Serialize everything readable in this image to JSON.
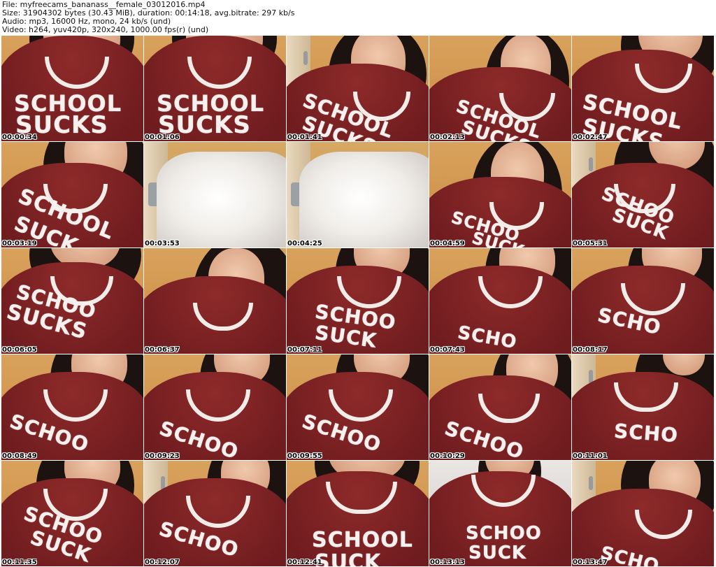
{
  "header": {
    "line1": "File: myfreecams_bananass__female_03012016.mp4",
    "line2": "Size: 31904302 bytes (30.43 MiB), duration: 00:14:18, avg.bitrate: 297 kb/s",
    "line3": "Audio: mp3, 16000 Hz, mono, 24 kb/s (und)",
    "line4": "Video: h264, yuv420p, 320x240, 1000.00 fps(r) (und)"
  },
  "thumbnails": [
    {
      "timestamp": "00:00:34",
      "print_line1": "SCHOOL",
      "print_line2": "SUCKS"
    },
    {
      "timestamp": "00:01:06",
      "print_line1": "SCHOOL",
      "print_line2": "SUCKS"
    },
    {
      "timestamp": "00:01:41",
      "print_line1": "SCHOOL",
      "print_line2": "SUCKS"
    },
    {
      "timestamp": "00:02:13",
      "print_line1": "SCHOOL",
      "print_line2": "SUCKS"
    },
    {
      "timestamp": "00:02:47",
      "print_line1": "SCHOOL",
      "print_line2": "SUCKS"
    },
    {
      "timestamp": "00:03:19",
      "print_line1": "SCHOOL",
      "print_line2": "SUCK"
    },
    {
      "timestamp": "00:03:53",
      "print_line1": "",
      "print_line2": ""
    },
    {
      "timestamp": "00:04:25",
      "print_line1": "",
      "print_line2": ""
    },
    {
      "timestamp": "00:04:59",
      "print_line1": "SCHOO",
      "print_line2": "SUCK"
    },
    {
      "timestamp": "00:05:31",
      "print_line1": "SCHOO",
      "print_line2": "SUCK"
    },
    {
      "timestamp": "00:06:05",
      "print_line1": "SCHOO",
      "print_line2": "SUCKS"
    },
    {
      "timestamp": "00:06:37",
      "print_line1": "",
      "print_line2": ""
    },
    {
      "timestamp": "00:07:11",
      "print_line1": "SCHOO",
      "print_line2": "SUCK"
    },
    {
      "timestamp": "00:07:43",
      "print_line1": "SCHO",
      "print_line2": ""
    },
    {
      "timestamp": "00:08:17",
      "print_line1": "SCHO",
      "print_line2": ""
    },
    {
      "timestamp": "00:08:49",
      "print_line1": "SCHOO",
      "print_line2": ""
    },
    {
      "timestamp": "00:09:23",
      "print_line1": "SCHOO",
      "print_line2": ""
    },
    {
      "timestamp": "00:09:55",
      "print_line1": "SCHOO",
      "print_line2": ""
    },
    {
      "timestamp": "00:10:29",
      "print_line1": "SCHOO",
      "print_line2": ""
    },
    {
      "timestamp": "00:11:01",
      "print_line1": "SCHO",
      "print_line2": ""
    },
    {
      "timestamp": "00:11:35",
      "print_line1": "SCHOO",
      "print_line2": "SUCK"
    },
    {
      "timestamp": "00:12:07",
      "print_line1": "SCHOO",
      "print_line2": ""
    },
    {
      "timestamp": "00:12:41",
      "print_line1": "SCHOOL",
      "print_line2": "SUCK"
    },
    {
      "timestamp": "00:13:13",
      "print_line1": "SCHOO",
      "print_line2": "SUCK"
    },
    {
      "timestamp": "00:13:47",
      "print_line1": "SCHO",
      "print_line2": ""
    }
  ],
  "colors": {
    "shirt": "#7a2226",
    "print": "#f6f1ee",
    "wall": "#d29a52"
  }
}
